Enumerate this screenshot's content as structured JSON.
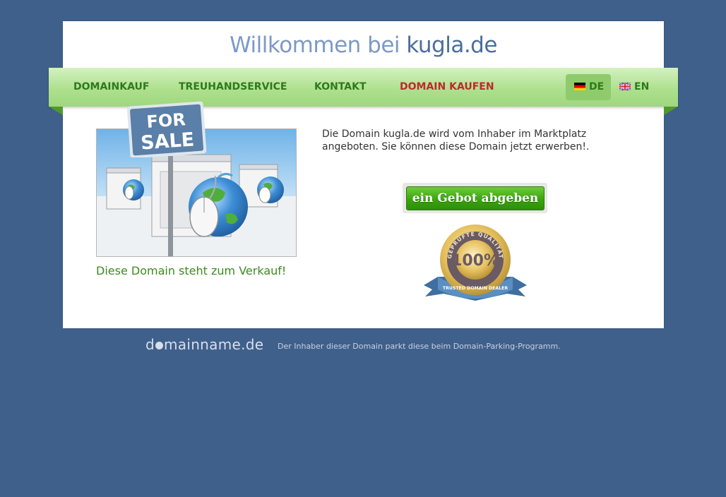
{
  "header": {
    "title_prefix": "Willkommen bei",
    "title_domain": "kugla.de"
  },
  "nav": {
    "items": [
      {
        "label": "DOMAINKAUF"
      },
      {
        "label": "TREUHANDSERVICE"
      },
      {
        "label": "KONTAKT"
      },
      {
        "label": "DOMAIN KAUFEN",
        "highlight_color": "#c0282c"
      }
    ],
    "languages": [
      {
        "code": "DE",
        "active": true,
        "flag": "flag-germany-icon"
      },
      {
        "code": "EN",
        "active": false,
        "flag": "flag-uk-icon"
      }
    ]
  },
  "main": {
    "sign_line1": "FOR",
    "sign_line2": "SALE",
    "caption": "Diese Domain steht zum Verkauf!",
    "description": "Die Domain kugla.de wird vom Inhaber im Marktplatz angeboten. Sie können diese Domain jetzt erwerben!.",
    "bid_button": "ein Gebot abgeben",
    "seal": {
      "top_text": "GEPRÜFTE QUALITÄT",
      "percent": "100%",
      "ribbon_text": "TRUSTED DOMAIN DEALER"
    }
  },
  "footer": {
    "logo_pre": "d",
    "logo_post": "mainname.de",
    "text": "Der Inhaber dieser Domain parkt diese beim Domain-Parking-Programm."
  },
  "colors": {
    "background": "#40608c",
    "nav_green": "#aee08e",
    "nav_text": "#2f7a1a",
    "accent_red": "#c0282c",
    "button_green": "#3aa50f"
  }
}
